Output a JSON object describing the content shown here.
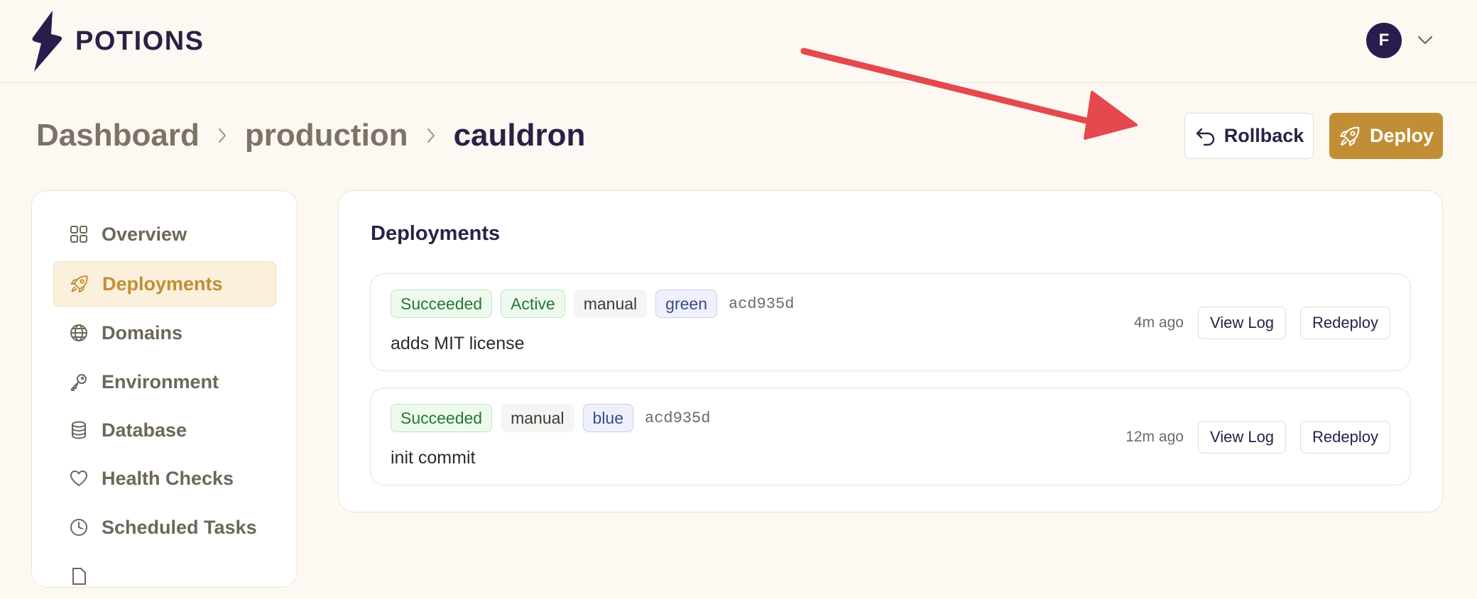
{
  "app": {
    "name": "POTIONS",
    "user_initial": "F"
  },
  "breadcrumb": [
    {
      "label": "Dashboard"
    },
    {
      "label": "production"
    },
    {
      "label": "cauldron"
    }
  ],
  "actions": {
    "rollback_label": "Rollback",
    "deploy_label": "Deploy"
  },
  "sidebar": {
    "items": [
      {
        "label": "Overview",
        "icon": "grid-icon",
        "active": false
      },
      {
        "label": "Deployments",
        "icon": "rocket-icon",
        "active": true
      },
      {
        "label": "Domains",
        "icon": "globe-icon",
        "active": false
      },
      {
        "label": "Environment",
        "icon": "key-icon",
        "active": false
      },
      {
        "label": "Database",
        "icon": "database-icon",
        "active": false
      },
      {
        "label": "Health Checks",
        "icon": "heart-icon",
        "active": false
      },
      {
        "label": "Scheduled Tasks",
        "icon": "clock-icon",
        "active": false
      }
    ]
  },
  "main": {
    "title": "Deployments",
    "deployments": [
      {
        "status": "Succeeded",
        "active_badge": "Active",
        "trigger": "manual",
        "environment": "green",
        "sha": "acd935d",
        "message": "adds MIT license",
        "time_ago": "4m ago",
        "view_log_label": "View Log",
        "redeploy_label": "Redeploy"
      },
      {
        "status": "Succeeded",
        "trigger": "manual",
        "environment": "blue",
        "sha": "acd935d",
        "message": "init commit",
        "time_ago": "12m ago",
        "view_log_label": "View Log",
        "redeploy_label": "Redeploy"
      }
    ]
  },
  "colors": {
    "background": "#fdf8f2",
    "brand_dark": "#2a1c4d",
    "accent": "#c28e35",
    "success": "#237a32",
    "annotation_arrow": "#e5484d"
  }
}
